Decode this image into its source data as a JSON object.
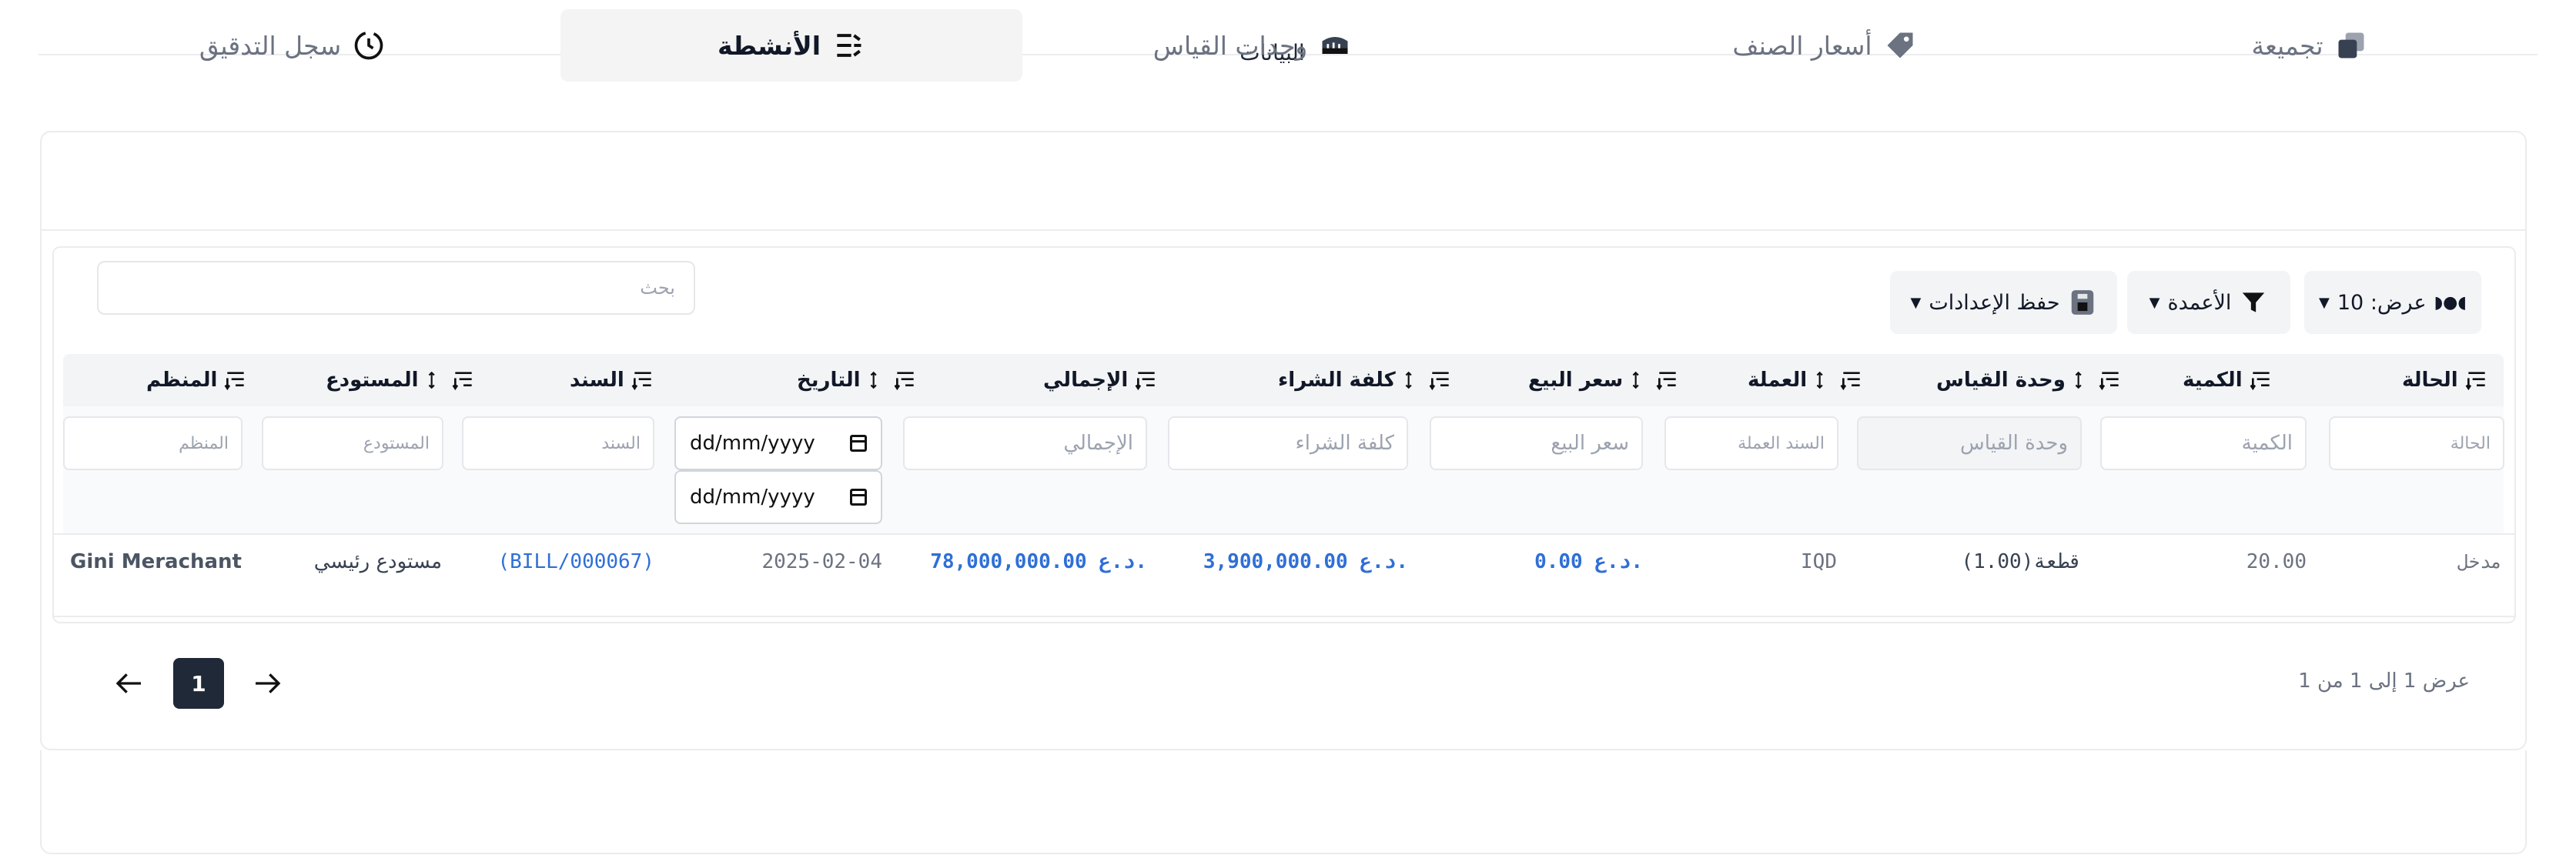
{
  "section_title": "البيانات",
  "tabs": [
    {
      "label": "تجميعة",
      "icon": "layers-icon"
    },
    {
      "label": "أسعار الصنف",
      "icon": "tag-icon"
    },
    {
      "label": "وحدات القياس",
      "icon": "ruler-icon"
    },
    {
      "label": "الأنشطة",
      "icon": "list-tree-icon",
      "active": true
    },
    {
      "label": "سجل التدقيق",
      "icon": "history-clock-icon"
    }
  ],
  "toolbar": {
    "show_label": "عرض: 10",
    "columns_label": "الأعمدة",
    "save_settings_label": "حفظ الإعدادات",
    "search_placeholder": "بحث"
  },
  "columns": [
    "الحالة",
    "الكمية",
    "وحدة القياس",
    "العملة",
    "سعر البيع",
    "كلفة الشراء",
    "الإجمالي",
    "التاريخ",
    "السند",
    "المستودع",
    "المنظم"
  ],
  "filters": {
    "status": "الحالة",
    "quantity": "الكمية",
    "uom": "وحدة القياس",
    "currency": "السند العملة",
    "sale_price": "سعر البيع",
    "purchase_cost": "كلفة الشراء",
    "total": "الإجمالي",
    "date_format": "dd/mm/yyyy",
    "voucher": "السند",
    "warehouse": "المستودع",
    "organizer": "المنظم"
  },
  "rows": [
    {
      "status": "مدخل",
      "quantity": "20.00",
      "uom": "قطعة(1.00)",
      "currency": "IQD",
      "sale_price": "0.00 د.ع.",
      "purchase_cost": "3,900,000.00 د.ع.",
      "total": "78,000,000.00 د.ع.",
      "date": "2025-02-04",
      "voucher": "(BILL/000067)",
      "warehouse": "مستودع رئيسي",
      "organizer": "Gini Merachant"
    }
  ],
  "pagination": {
    "info": "عرض 1 إلى 1 من 1",
    "current_page": "1"
  },
  "colors": {
    "accent_blue": "#2f6fd6",
    "active_page": "#1f2937",
    "active_tab_bg": "#f4f4f5"
  }
}
